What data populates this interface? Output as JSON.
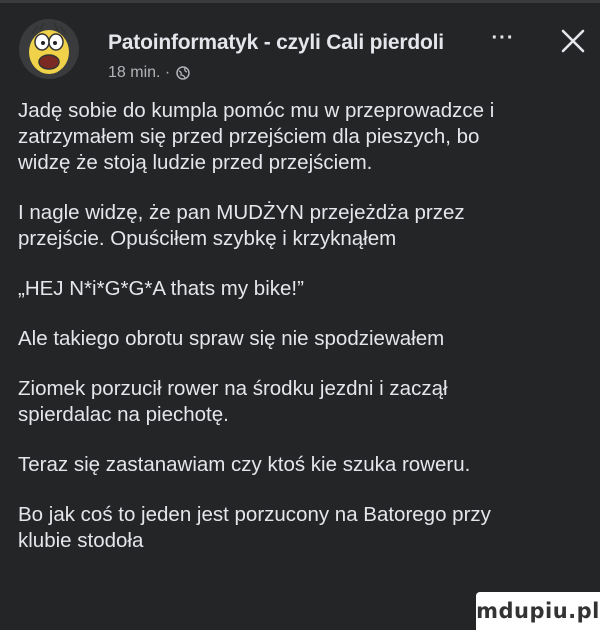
{
  "post": {
    "author": "Patoinformatyk - czyli Cali pierdoli",
    "time": "18 min. ·",
    "more_label": "···",
    "paragraphs": [
      [
        "Jadę sobie do kumpla pomóc mu w przeprowadzce i",
        "zatrzymałem się przed przejściem dla pieszych, bo",
        "widzę że stoją ludzie przed przejściem."
      ],
      [
        "I nagle widzę, że pan MUDŻYN przejeżdża przez",
        "przejście. Opuściłem szybkę i krzyknąłem"
      ],
      [
        "„HEJ N*i*G*G*A thats my bike!”"
      ],
      [
        "Ale takiego obrotu spraw się nie spodziewałem"
      ],
      [
        "Ziomek porzucił rower na środku jezdni i zaczął",
        "spierdalac na piechotę."
      ],
      [
        "Teraz się zastanawiam czy ktoś kie szuka roweru."
      ],
      [
        "Bo jak coś to jeden jest porzucony na Batorego przy",
        "klubie stodoła"
      ]
    ]
  },
  "icons": {
    "avatar": "avatar",
    "globe": "globe-icon",
    "more": "more-icon",
    "close": "close-icon"
  },
  "watermark": "mdupiu.pl",
  "colors": {
    "background": "#242526",
    "text": "#e4e6eb",
    "muted": "#b0b3b8"
  }
}
